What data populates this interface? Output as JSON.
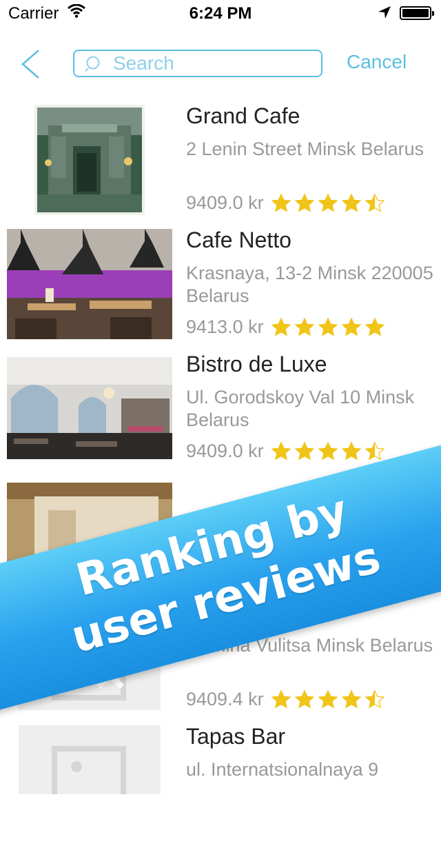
{
  "status_bar": {
    "carrier": "Carrier",
    "time": "6:24 PM"
  },
  "nav": {
    "search_placeholder": "Search",
    "cancel_label": "Cancel"
  },
  "places": [
    {
      "name": "Grand Cafe",
      "address": "2 Lenin Street Minsk Belarus",
      "price": "9409.0 kr",
      "rating": 4.5
    },
    {
      "name": "Cafe Netto",
      "address": "Krasnaya, 13-2 Minsk 220005 Belarus",
      "price": "9413.0 kr",
      "rating": 5
    },
    {
      "name": "Bistro de Luxe",
      "address": "Ul. Gorodskoy Val 10 Minsk  Belarus",
      "price": "9409.0 kr",
      "rating": 4.5
    },
    {
      "name": "",
      "address": "Lyenina Vulitsa Minsk Belarus",
      "price": "9409.4 kr",
      "rating": 4.5
    },
    {
      "name": "Tapas Bar",
      "address": "ul. Internatsionalnaya 9",
      "price": "",
      "rating": 0
    }
  ],
  "banner": {
    "line1": "Ranking by",
    "line2": "user reviews"
  },
  "colors": {
    "accent": "#5bbfe0",
    "star": "#f0c419",
    "banner": "#2aa2ee"
  }
}
